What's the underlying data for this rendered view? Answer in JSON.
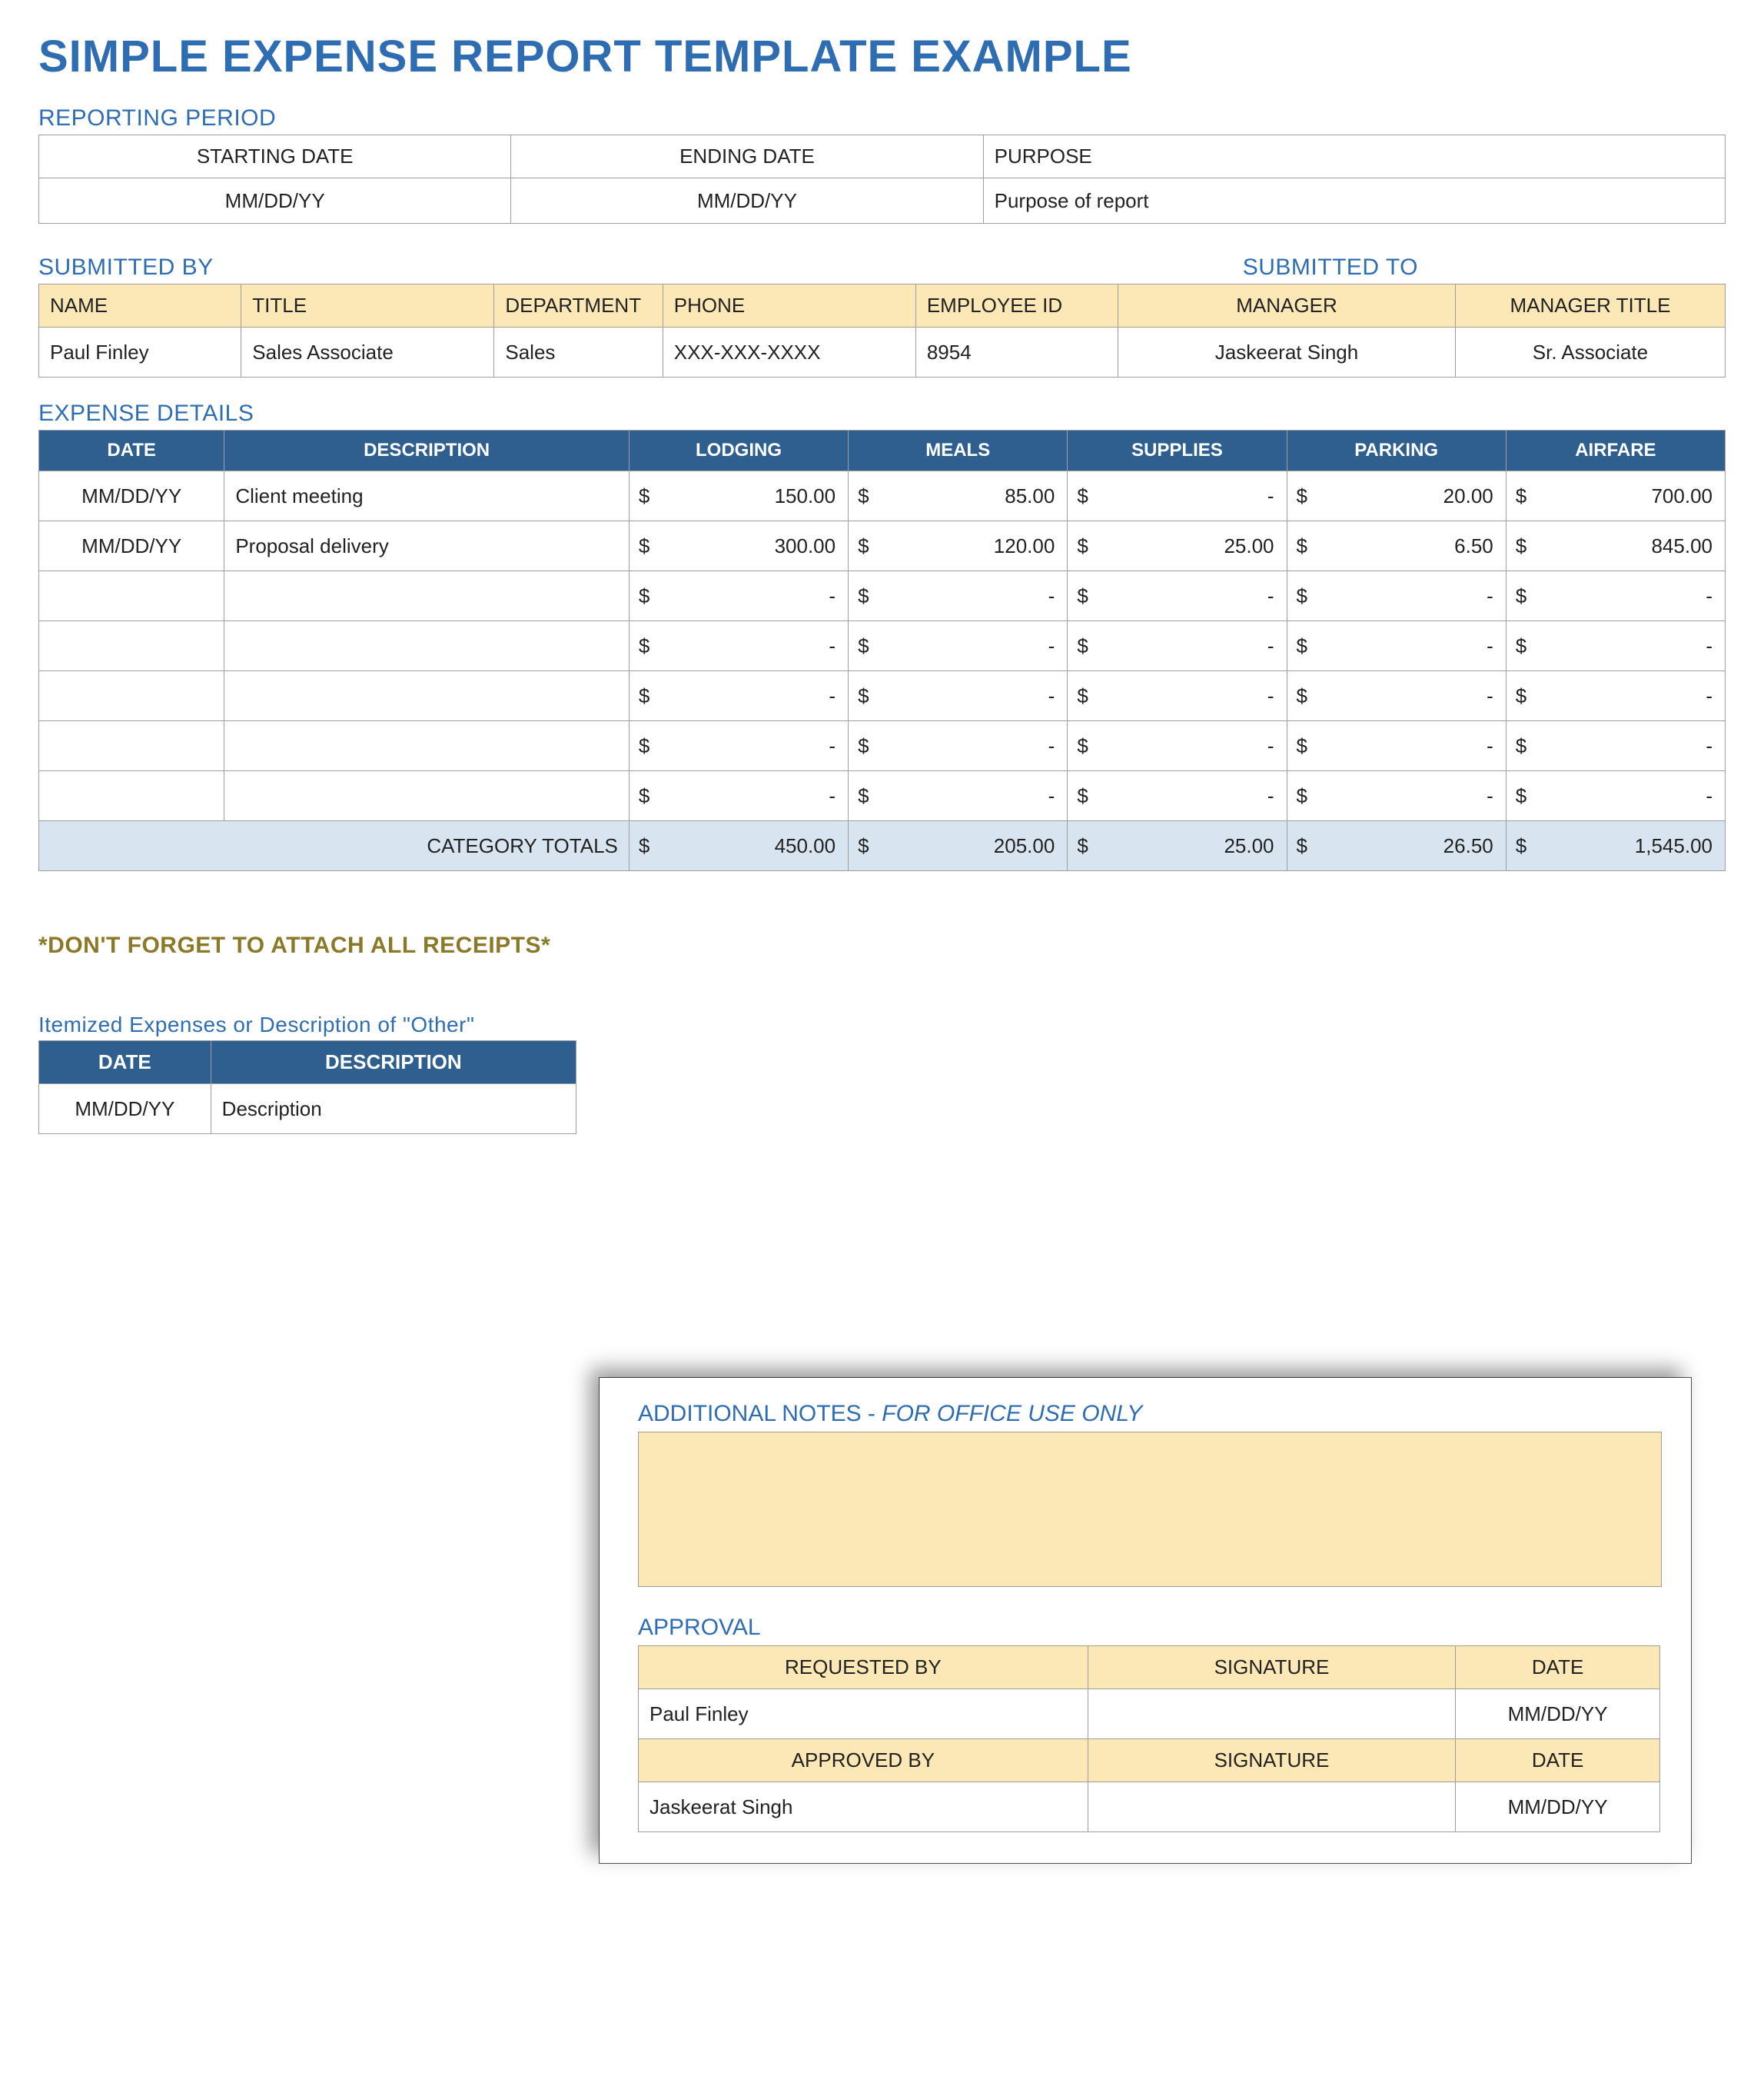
{
  "title": "SIMPLE EXPENSE REPORT TEMPLATE EXAMPLE",
  "reporting_period": {
    "label": "REPORTING PERIOD",
    "headers": {
      "start": "STARTING DATE",
      "end": "ENDING DATE",
      "purpose": "PURPOSE"
    },
    "values": {
      "start": "MM/DD/YY",
      "end": "MM/DD/YY",
      "purpose": "Purpose of report"
    }
  },
  "submitted_by": {
    "label": "SUBMITTED BY",
    "headers": {
      "name": "NAME",
      "title": "TITLE",
      "department": "DEPARTMENT",
      "phone": "PHONE",
      "employee_id": "EMPLOYEE ID"
    },
    "values": {
      "name": "Paul Finley",
      "title": "Sales Associate",
      "department": "Sales",
      "phone": "XXX-XXX-XXXX",
      "employee_id": "8954"
    }
  },
  "submitted_to": {
    "label": "SUBMITTED TO",
    "headers": {
      "manager": "MANAGER",
      "manager_title": "MANAGER TITLE"
    },
    "values": {
      "manager": "Jaskeerat Singh",
      "manager_title": "Sr. Associate"
    }
  },
  "expense_details": {
    "label": "EXPENSE DETAILS",
    "headers": {
      "date": "DATE",
      "description": "DESCRIPTION",
      "lodging": "LODGING",
      "meals": "MEALS",
      "supplies": "SUPPLIES",
      "parking": "PARKING",
      "airfare": "AIRFARE"
    },
    "rows": [
      {
        "date": "MM/DD/YY",
        "description": "Client meeting",
        "lodging": "150.00",
        "meals": "85.00",
        "supplies": "-",
        "parking": "20.00",
        "airfare": "700.00"
      },
      {
        "date": "MM/DD/YY",
        "description": "Proposal delivery",
        "lodging": "300.00",
        "meals": "120.00",
        "supplies": "25.00",
        "parking": "6.50",
        "airfare": "845.00"
      },
      {
        "date": "",
        "description": "",
        "lodging": "-",
        "meals": "-",
        "supplies": "-",
        "parking": "-",
        "airfare": "-"
      },
      {
        "date": "",
        "description": "",
        "lodging": "-",
        "meals": "-",
        "supplies": "-",
        "parking": "-",
        "airfare": "-"
      },
      {
        "date": "",
        "description": "",
        "lodging": "-",
        "meals": "-",
        "supplies": "-",
        "parking": "-",
        "airfare": "-"
      },
      {
        "date": "",
        "description": "",
        "lodging": "-",
        "meals": "-",
        "supplies": "-",
        "parking": "-",
        "airfare": "-"
      },
      {
        "date": "",
        "description": "",
        "lodging": "-",
        "meals": "-",
        "supplies": "-",
        "parking": "-",
        "airfare": "-"
      }
    ],
    "totals_label": "CATEGORY TOTALS",
    "totals": {
      "lodging": "450.00",
      "meals": "205.00",
      "supplies": "25.00",
      "parking": "26.50",
      "airfare": "1,545.00"
    }
  },
  "receipts_note": "*DON'T FORGET TO ATTACH ALL RECEIPTS*",
  "itemized": {
    "label": "Itemized Expenses or Description of \"Other\"",
    "headers": {
      "date": "DATE",
      "description": "DESCRIPTION"
    },
    "row": {
      "date": "MM/DD/YY",
      "description": "Description"
    }
  },
  "modal": {
    "notes_label": "ADDITIONAL NOTES - ",
    "notes_italic": "FOR OFFICE USE ONLY",
    "approval_label": "APPROVAL",
    "headers1": {
      "requested": "REQUESTED BY",
      "signature": "SIGNATURE",
      "date": "DATE"
    },
    "row1": {
      "requested": "Paul Finley",
      "signature": "",
      "date": "MM/DD/YY"
    },
    "headers2": {
      "approved": "APPROVED BY",
      "signature": "SIGNATURE",
      "date": "DATE"
    },
    "row2": {
      "approved": "Jaskeerat Singh",
      "signature": "",
      "date": "MM/DD/YY"
    }
  }
}
